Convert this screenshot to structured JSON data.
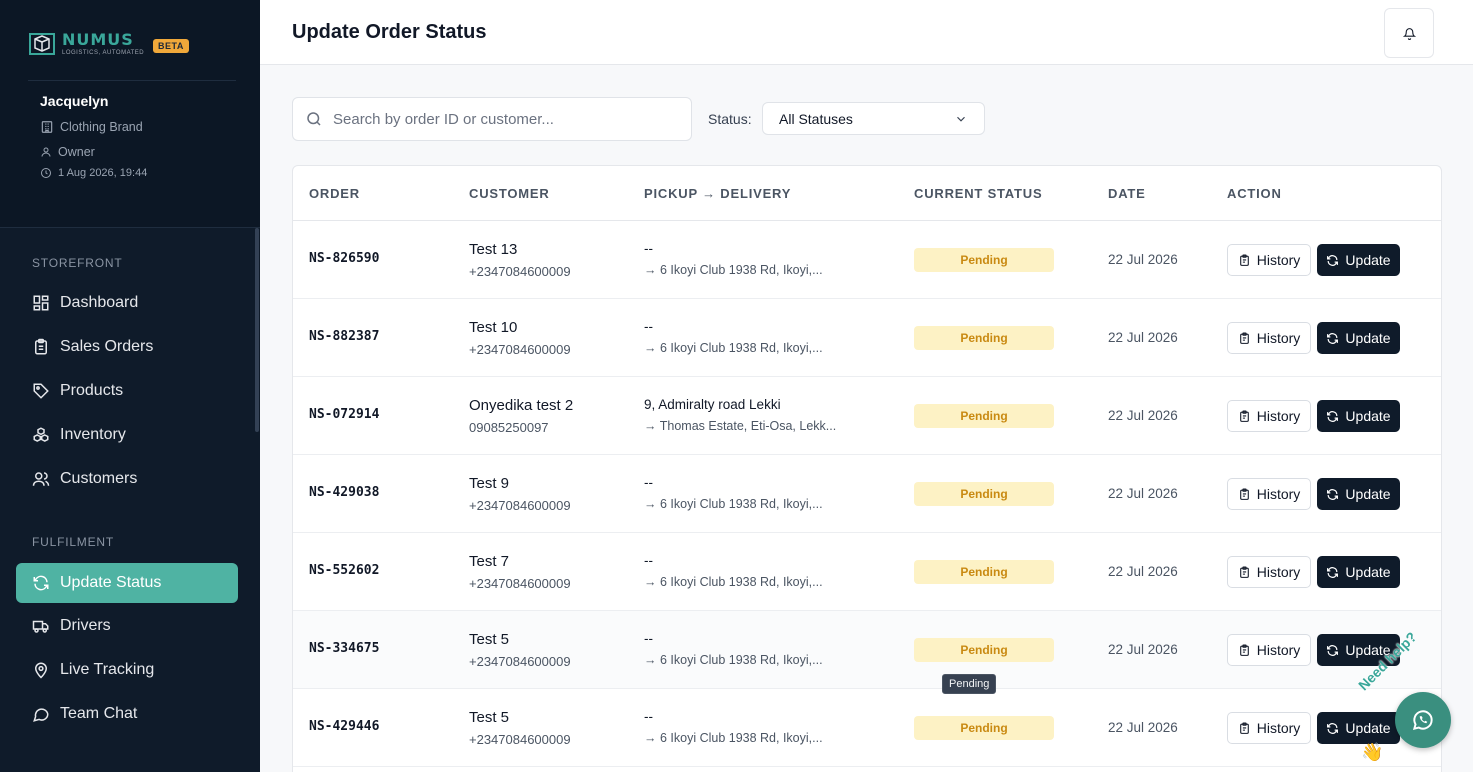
{
  "brand": {
    "name": "NUMUS",
    "tagline": "LOGISTICS, AUTOMATED",
    "badge": "BETA"
  },
  "user": {
    "name": "Jacquelyn",
    "company": "Clothing Brand",
    "role": "Owner",
    "datetime": "1 Aug 2026, 19:44"
  },
  "sidebar": {
    "storefront_label": "STOREFRONT",
    "storefront": [
      {
        "label": "Dashboard"
      },
      {
        "label": "Sales Orders"
      },
      {
        "label": "Products"
      },
      {
        "label": "Inventory"
      },
      {
        "label": "Customers"
      }
    ],
    "fulfilment_label": "FULFILMENT",
    "fulfilment": [
      {
        "label": "Update Status"
      },
      {
        "label": "Drivers"
      },
      {
        "label": "Live Tracking"
      },
      {
        "label": "Team Chat"
      }
    ]
  },
  "header": {
    "title": "Update Order Status"
  },
  "filters": {
    "search_placeholder": "Search by order ID or customer...",
    "status_label": "Status:",
    "status_value": "All Statuses"
  },
  "table": {
    "columns": [
      "ORDER",
      "CUSTOMER",
      "PICKUP → DELIVERY",
      "CURRENT STATUS",
      "DATE",
      "ACTION"
    ],
    "history_label": "History",
    "update_label": "Update",
    "rows": [
      {
        "order": "NS-826590",
        "customer": "Test 13",
        "phone": "+2347084600009",
        "pickup": "--",
        "delivery": "→ 6 Ikoyi Club 1938 Rd, Ikoyi,...",
        "status": "Pending",
        "date": "22 Jul 2026"
      },
      {
        "order": "NS-882387",
        "customer": "Test 10",
        "phone": "+2347084600009",
        "pickup": "--",
        "delivery": "→ 6 Ikoyi Club 1938 Rd, Ikoyi,...",
        "status": "Pending",
        "date": "22 Jul 2026"
      },
      {
        "order": "NS-072914",
        "customer": "Onyedika test 2",
        "phone": "09085250097",
        "pickup": "9, Admiralty road Lekki",
        "delivery": "→ Thomas Estate, Eti-Osa, Lekk...",
        "status": "Pending",
        "date": "22 Jul 2026"
      },
      {
        "order": "NS-429038",
        "customer": "Test 9",
        "phone": "+2347084600009",
        "pickup": "--",
        "delivery": "→ 6 Ikoyi Club 1938 Rd, Ikoyi,...",
        "status": "Pending",
        "date": "22 Jul 2026"
      },
      {
        "order": "NS-552602",
        "customer": "Test 7",
        "phone": "+2347084600009",
        "pickup": "--",
        "delivery": "→ 6 Ikoyi Club 1938 Rd, Ikoyi,...",
        "status": "Pending",
        "date": "22 Jul 2026"
      },
      {
        "order": "NS-334675",
        "customer": "Test 5",
        "phone": "+2347084600009",
        "pickup": "--",
        "delivery": "→ 6 Ikoyi Club 1938 Rd, Ikoyi,...",
        "status": "Pending",
        "date": "22 Jul 2026"
      },
      {
        "order": "NS-429446",
        "customer": "Test 5",
        "phone": "+2347084600009",
        "pickup": "--",
        "delivery": "→ 6 Ikoyi Club 1938 Rd, Ikoyi,...",
        "status": "Pending",
        "date": "22 Jul 2026"
      }
    ]
  },
  "tooltip": {
    "text": "Pending"
  },
  "help": {
    "text": "Need help?",
    "wave": "👋"
  },
  "colors": {
    "accent": "#4fb3a3",
    "sidebar_bg": "#0f1b2a",
    "pending_bg": "#fdf2c5",
    "pending_text": "#c98a12",
    "beta": "#f0a83a"
  }
}
